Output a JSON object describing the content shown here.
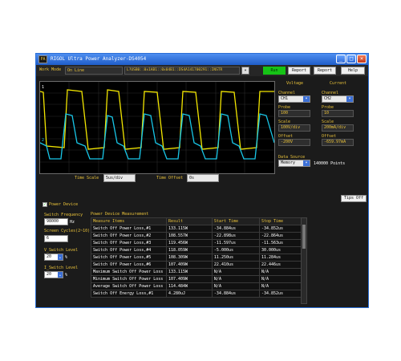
{
  "window": {
    "title": "RIGOL Ultra Power Analyzer-DS4054",
    "icon_text": "PA"
  },
  "toolbar": {
    "work_mode_label": "Work Mode",
    "work_mode_value": "On Line",
    "device": "L?USB0::0x1AB1::0x04B1::DS4A141700291::INSTR",
    "run_label": "Run",
    "report_label": "Report",
    "export_label": "Report",
    "help_label": "Help"
  },
  "scope": {
    "time_scale_label": "Time Scale",
    "time_scale_value": "5us/div",
    "time_offset_label": "Time Offset",
    "time_offset_value": "0s"
  },
  "voltage": {
    "header": "Voltage",
    "channel_label": "Channel",
    "channel_value": "CH1",
    "probe_label": "Probe",
    "probe_value": "100",
    "scale_label": "Scale",
    "scale_value": "100V/div",
    "offset_label": "Offset",
    "offset_value": "-200V"
  },
  "current": {
    "header": "Current",
    "channel_label": "Channel",
    "channel_value": "CH2",
    "probe_label": "Probe",
    "probe_value": "10",
    "scale_label": "Scale",
    "scale_value": "200mA/div",
    "offset_label": "Offset",
    "offset_value": "-659.97mA"
  },
  "source": {
    "label": "Data Source",
    "value": "Memory",
    "points": "140000 Points"
  },
  "tips": "Tips Off",
  "power_device": {
    "checkbox_label": "Power Device",
    "switch_freq_label": "Switch Frequency",
    "switch_freq_value": "98000",
    "switch_freq_unit": "Hz",
    "screen_cycles_label": "Screen Cycles(2~10)",
    "screen_cycles_value": "6",
    "v_switch_label": "V_Switch Level",
    "v_switch_value": "20",
    "i_switch_label": "I_Switch Level",
    "i_switch_value": "20",
    "pct": "%",
    "measure_title": "Power Device Measurement",
    "headers": [
      "Measure Items",
      "Result",
      "Start Time",
      "Stop Time"
    ],
    "rows": [
      [
        "Switch Off Power Loss,#1",
        "133.115W",
        "-34.884us",
        "-34.852us"
      ],
      [
        "Switch Off Power Loss,#2",
        "108.557W",
        "-22.898us",
        "-22.864us"
      ],
      [
        "Switch Off Power Loss,#3",
        "119.456W",
        "-11.597us",
        "-11.563us"
      ],
      [
        "Switch Off Power Loss,#4",
        "118.059W",
        "-5.000us",
        "30.000us"
      ],
      [
        "Switch Off Power Loss,#5",
        "108.309W",
        "11.250us",
        "11.284us"
      ],
      [
        "Switch Off Power Loss,#6",
        "107.409W",
        "22.410us",
        "22.446us"
      ],
      [
        "Maximum Switch Off Power Loss",
        "133.115W",
        "N/A",
        "N/A"
      ],
      [
        "Minimum Switch Off Power Loss",
        "107.409W",
        "N/A",
        "N/A"
      ],
      [
        "Average Switch Off Power Loss",
        "114.484W",
        "N/A",
        "N/A"
      ],
      [
        "Switch Off Energy Loss,#1",
        "4.280uJ",
        "-34.884us",
        "-34.852us"
      ]
    ]
  }
}
